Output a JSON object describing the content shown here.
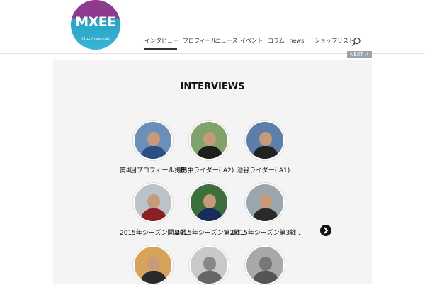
{
  "logo": {
    "text": "MXEE",
    "url": "http://mxee.net"
  },
  "nav": {
    "items": [
      {
        "label": "インタビュー",
        "active": true
      },
      {
        "label": "プロフィール",
        "active": false
      },
      {
        "label": "ニュース",
        "active": false
      },
      {
        "label": "イベント",
        "active": false
      },
      {
        "label": "コラム",
        "active": false
      },
      {
        "label": "news",
        "active": false
      },
      {
        "label": "ショップリスト",
        "active": false
      }
    ]
  },
  "next_label": "NEXT",
  "section": {
    "title": "INTERVIEWS"
  },
  "cards": [
    {
      "caption": "第4回プロフィール撮影会..."
    },
    {
      "caption": "田中ライダー(IA2)..."
    },
    {
      "caption": "池谷ライダー(IA1)..."
    },
    {
      "caption": "2015年シーズン開幕戦..."
    },
    {
      "caption": "2015年シーズン第2戦..."
    },
    {
      "caption": "2015年シーズン第3戦..."
    },
    {
      "caption": ""
    },
    {
      "caption": ""
    },
    {
      "caption": ""
    }
  ],
  "colors": {
    "logo_top": "#8e3a8f",
    "logo_bottom": "#37b4d6",
    "panel": "#f4f4f4"
  },
  "icons": {
    "search": "search-icon",
    "next_arrow": "chevron-right-icon"
  }
}
